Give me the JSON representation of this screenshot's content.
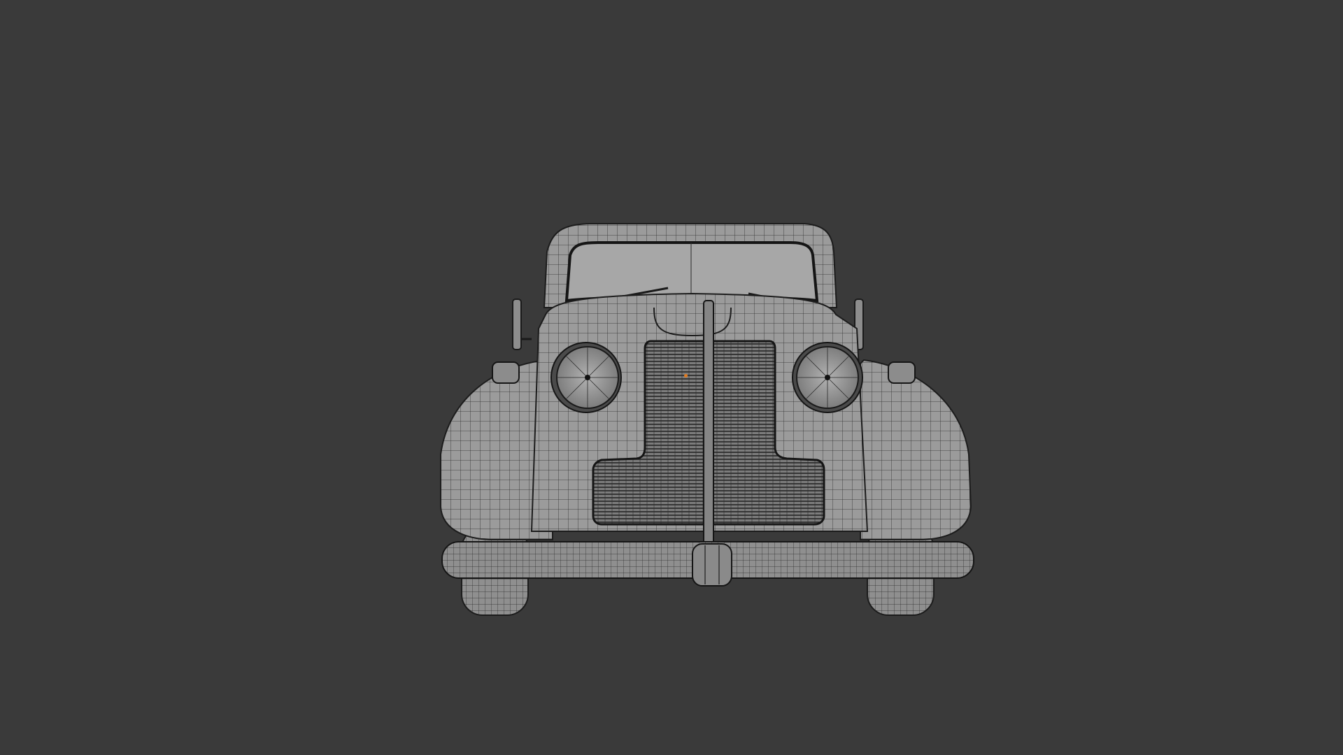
{
  "viewport": {
    "background": "#3a3a3a",
    "mode": "wireframe-overlay",
    "view": "front-orthographic"
  },
  "model": {
    "subject": "vintage car",
    "surface_color": "#9b9b9b",
    "wire_color": "#1e1e1e",
    "origin_color": "#e07a1f"
  }
}
